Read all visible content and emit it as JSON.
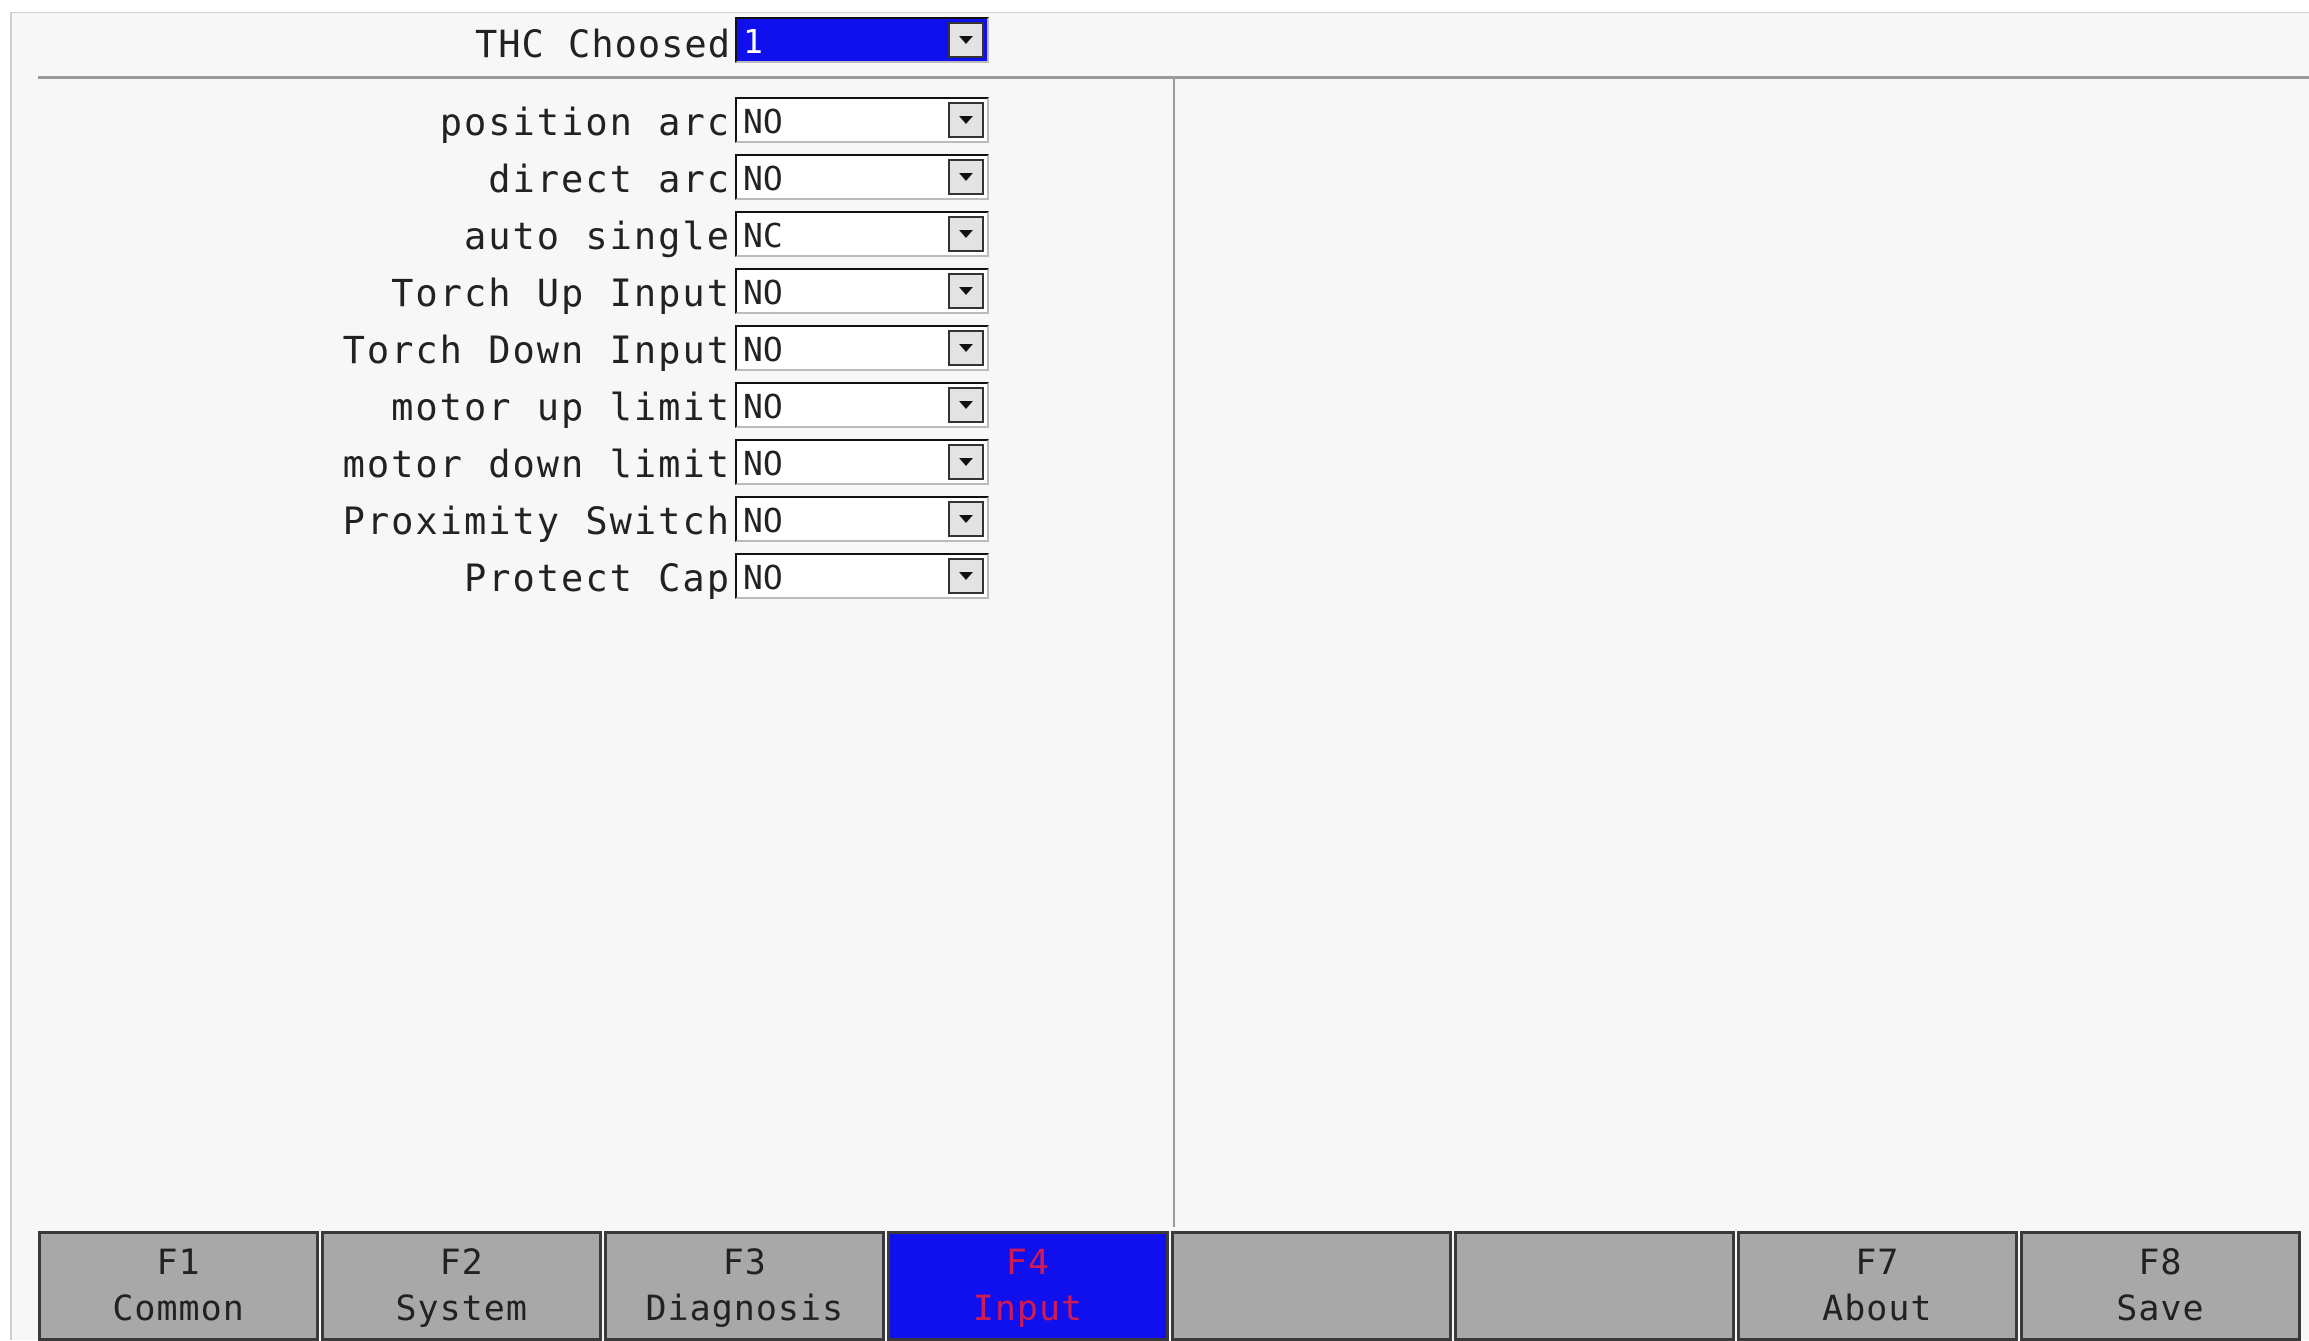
{
  "header": {
    "thc_label": "THC Choosed",
    "thc_value": "1"
  },
  "settings": [
    {
      "label": "position arc",
      "value": "NO"
    },
    {
      "label": "direct arc",
      "value": "NO"
    },
    {
      "label": "auto single",
      "value": "NC"
    },
    {
      "label": "Torch Up Input",
      "value": "NO"
    },
    {
      "label": "Torch Down Input",
      "value": "NO"
    },
    {
      "label": "motor up limit",
      "value": "NO"
    },
    {
      "label": "motor down limit",
      "value": "NO"
    },
    {
      "label": "Proximity Switch",
      "value": "NO"
    },
    {
      "label": "Protect Cap",
      "value": "NO"
    }
  ],
  "function_keys": [
    {
      "key": "F1",
      "label": "Common",
      "active": false
    },
    {
      "key": "F2",
      "label": "System",
      "active": false
    },
    {
      "key": "F3",
      "label": "Diagnosis",
      "active": false
    },
    {
      "key": "F4",
      "label": "Input",
      "active": true
    },
    {
      "key": "",
      "label": "",
      "active": false
    },
    {
      "key": "",
      "label": "",
      "active": false
    },
    {
      "key": "F7",
      "label": "About",
      "active": false
    },
    {
      "key": "F8",
      "label": "Save",
      "active": false
    }
  ],
  "colors": {
    "selected": "#1010ee",
    "active_key_text": "#d01a52",
    "key_bg": "#a8a8a8"
  }
}
